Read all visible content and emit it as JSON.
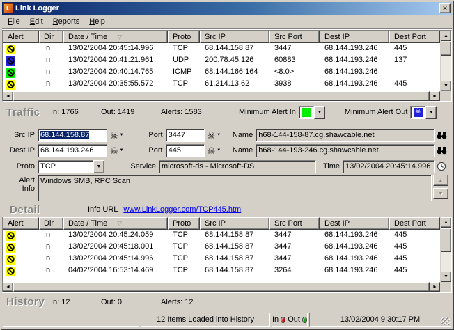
{
  "window": {
    "title": "Link Logger"
  },
  "icons": {
    "logo_letter": "L",
    "close": "✕",
    "sort_down": "▽",
    "skull": "☠",
    "dropdown_arrow": "▼",
    "scroll_up": "▲",
    "scroll_down": "▼",
    "scroll_left": "◄",
    "scroll_right": "►"
  },
  "menu": {
    "items": [
      {
        "label": "File"
      },
      {
        "label": "Edit"
      },
      {
        "label": "Reports"
      },
      {
        "label": "Help"
      }
    ]
  },
  "columns": {
    "alert": "Alert",
    "dir": "Dir",
    "datetime": "Date / Time",
    "proto": "Proto",
    "src_ip": "Src IP",
    "src_port": "Src Port",
    "dest_ip": "Dest IP",
    "dest_port": "Dest Port"
  },
  "traffic_table": {
    "rows": [
      {
        "alert_color": "#ffff00",
        "dir": "In",
        "datetime": "13/02/2004 20:45:14.996",
        "proto": "TCP",
        "src_ip": "68.144.158.87",
        "src_port": "3447",
        "dest_ip": "68.144.193.246",
        "dest_port": "445"
      },
      {
        "alert_color": "#2222dd",
        "dir": "In",
        "datetime": "13/02/2004 20:41:21.961",
        "proto": "UDP",
        "src_ip": "200.78.45.126",
        "src_port": "60883",
        "dest_ip": "68.144.193.246",
        "dest_port": "137"
      },
      {
        "alert_color": "#00ee00",
        "dir": "In",
        "datetime": "13/02/2004 20:40:14.765",
        "proto": "ICMP",
        "src_ip": "68.144.166.164",
        "src_port": "<8:0>",
        "dest_ip": "68.144.193.246",
        "dest_port": ""
      },
      {
        "alert_color": "#ffff00",
        "dir": "In",
        "datetime": "13/02/2004 20:35:55.572",
        "proto": "TCP",
        "src_ip": "61.214.13.62",
        "src_port": "3938",
        "dest_ip": "68.144.193.246",
        "dest_port": "445"
      }
    ]
  },
  "traffic_summary": {
    "label": "Traffic",
    "in": "In: 1766",
    "out": "Out: 1419",
    "alerts": "Alerts: 1583",
    "min_alert_in_label": "Minimum Alert In",
    "min_alert_in_color": "#00ee00",
    "min_alert_out_label": "Minimum Alert Out",
    "min_alert_out_color": "#2222dd"
  },
  "detail": {
    "src_ip_label": "Src IP",
    "src_ip": "68.144.158.87",
    "src_port_label": "Port",
    "src_port": "3447",
    "src_name_label": "Name",
    "src_name": "h68-144-158-87.cg.shawcable.net",
    "dest_ip_label": "Dest IP",
    "dest_ip": "68.144.193.246",
    "dest_port_label": "Port",
    "dest_port": "445",
    "dest_name_label": "Name",
    "dest_name": "h68-144-193-246.cg.shawcable.net",
    "proto_label": "Proto",
    "proto": "TCP",
    "service_label": "Service",
    "service": "microsoft-ds - Microsoft-DS",
    "time_label": "Time",
    "time": "13/02/2004 20:45:14.996",
    "alert_info_label": "Alert Info",
    "alert_info": "Windows SMB, RPC Scan",
    "detail_label": "Detail",
    "info_url_label": "Info URL",
    "info_url": "www.LinkLogger.com/TCP445.htm"
  },
  "history_table": {
    "rows": [
      {
        "alert_color": "#ffff00",
        "dir": "In",
        "datetime": "13/02/2004 20:45:24.059",
        "proto": "TCP",
        "src_ip": "68.144.158.87",
        "src_port": "3447",
        "dest_ip": "68.144.193.246",
        "dest_port": "445"
      },
      {
        "alert_color": "#ffff00",
        "dir": "In",
        "datetime": "13/02/2004 20:45:18.001",
        "proto": "TCP",
        "src_ip": "68.144.158.87",
        "src_port": "3447",
        "dest_ip": "68.144.193.246",
        "dest_port": "445"
      },
      {
        "alert_color": "#ffff00",
        "dir": "In",
        "datetime": "13/02/2004 20:45:14.996",
        "proto": "TCP",
        "src_ip": "68.144.158.87",
        "src_port": "3447",
        "dest_ip": "68.144.193.246",
        "dest_port": "445"
      },
      {
        "alert_color": "#ffff00",
        "dir": "In",
        "datetime": "04/02/2004 16:53:14.469",
        "proto": "TCP",
        "src_ip": "68.144.158.87",
        "src_port": "3264",
        "dest_ip": "68.144.193.246",
        "dest_port": "445"
      }
    ]
  },
  "history_summary": {
    "label": "History",
    "in": "In: 12",
    "out": "Out: 0",
    "alerts": "Alerts: 12"
  },
  "status_bar": {
    "message": "12 Items Loaded into History",
    "in_label": "In",
    "in_led_color": "#cc1111",
    "out_label": "Out",
    "out_led_color": "#11aa11",
    "clock": "13/02/2004 9:30:17 PM"
  }
}
